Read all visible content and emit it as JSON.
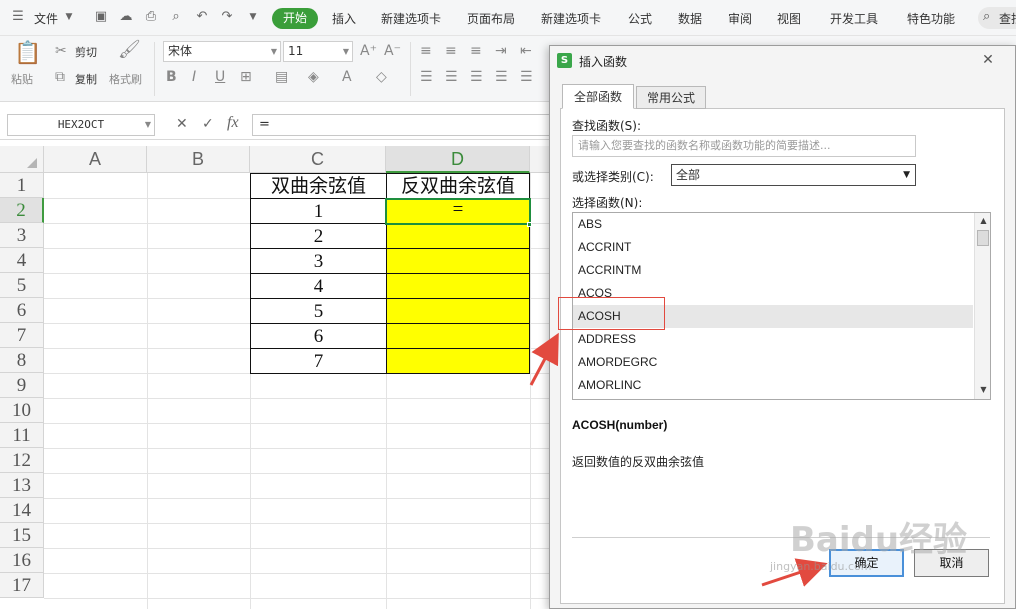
{
  "menubar": {
    "file": "文件",
    "tabs": [
      "开始",
      "插入",
      "新建选项卡",
      "页面布局",
      "新建选项卡",
      "公式",
      "数据",
      "审阅",
      "视图",
      "开发工具",
      "特色功能"
    ],
    "search": "查找"
  },
  "ribbon": {
    "paste": "粘贴",
    "cut": "剪切",
    "copy": "复制",
    "format_painter": "格式刷",
    "font_name": "宋体",
    "font_size": "11"
  },
  "formula_bar": {
    "name_box": "HEX2OCT",
    "formula": "="
  },
  "sheet": {
    "columns": [
      "A",
      "B",
      "C",
      "D"
    ],
    "rows": [
      "1",
      "2",
      "3",
      "4",
      "5",
      "6",
      "7",
      "8",
      "9",
      "10",
      "11",
      "12",
      "13",
      "14",
      "15",
      "16",
      "17"
    ],
    "c_header": "双曲余弦值",
    "d_header": "反双曲余弦值",
    "c_values": [
      "1",
      "2",
      "3",
      "4",
      "5",
      "6",
      "7"
    ],
    "d2_value": "=",
    "highlight_color": "#ffff00"
  },
  "dialog": {
    "title": "插入函数",
    "app_badge": "S",
    "tab_all": "全部函数",
    "tab_common": "常用公式",
    "search_label": "查找函数(S):",
    "search_placeholder": "请输入您要查找的函数名称或函数功能的简要描述...",
    "category_label": "或选择类别(C):",
    "category_value": "全部",
    "list_label": "选择函数(N):",
    "functions": [
      "ABS",
      "ACCRINT",
      "ACCRINTM",
      "ACOS",
      "ACOSH",
      "ADDRESS",
      "AMORDEGRC",
      "AMORLINC"
    ],
    "selected_function": "ACOSH",
    "signature": "ACOSH(number)",
    "description": "返回数值的反双曲余弦值",
    "ok": "确定",
    "cancel": "取消"
  },
  "colors": {
    "accent_green": "#3a9e3a",
    "annotation_red": "#e24a3f"
  },
  "watermark": {
    "brand": "Baidu经验",
    "url": "jingyan.baidu.com"
  }
}
